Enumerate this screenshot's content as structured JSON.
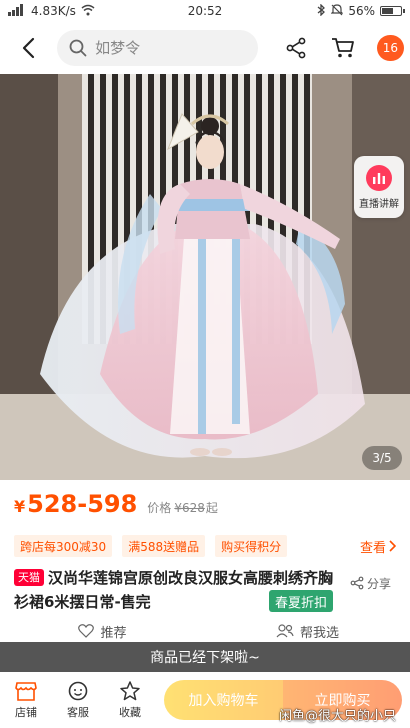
{
  "status_bar": {
    "network_speed": "4.83K/s",
    "time": "20:52",
    "battery": "56%"
  },
  "nav": {
    "search_placeholder": "如梦令",
    "message_badge": "16"
  },
  "gallery": {
    "live_label": "直播讲解",
    "counter": "3/5"
  },
  "price": {
    "symbol": "¥",
    "range": "528-598",
    "original_label": "价格",
    "original_price": "¥628",
    "original_suffix": "起"
  },
  "promotions": {
    "tags": [
      "跨店每300减30",
      "满588送赠品",
      "购买得积分"
    ],
    "more_label": "查看"
  },
  "title": {
    "platform_tag": "天猫",
    "text": "汉尚华莲锦宫原创改良汉服女高腰刺绣齐胸衫裙6米摆日常-售完",
    "season_tag": "春夏折扣",
    "share_label": "分享"
  },
  "actions": {
    "recommend_label": "推荐",
    "help_label": "帮我选"
  },
  "offline_banner": "商品已经下架啦~",
  "bottom_bar": {
    "shop_label": "店铺",
    "service_label": "客服",
    "favorite_label": "收藏",
    "add_cart_label": "加入购物车",
    "buy_now_label": "立即购买"
  },
  "watermark": "闲鱼@很大只的小只",
  "colors": {
    "accent": "#ff5000",
    "tmall_red": "#ff0036",
    "season_green": "#2ea56f",
    "banner_gray": "#555555"
  }
}
